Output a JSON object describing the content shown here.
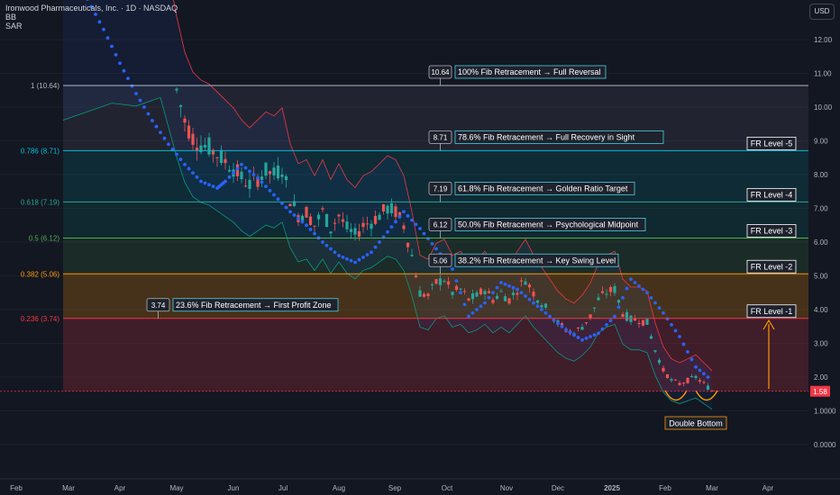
{
  "header": {
    "title": "Ironwood Pharmaceuticals, Inc. · 1D · NASDAQ",
    "indicator_1": "BB",
    "indicator_2": "SAR",
    "currency_button": "USD"
  },
  "colors": {
    "background": "#131722",
    "candle_up": "#26a69a",
    "candle_down": "#ef5350",
    "sar_dots": "#2962ff",
    "bb_band": "#089981",
    "accent_orange": "#ff9800",
    "label_border": "#4dd0e1",
    "price_tag": "#f23645"
  },
  "chart_data": {
    "type": "candlestick",
    "y_axis": {
      "ticks": [
        "12.00",
        "11.00",
        "10.00",
        "9.00",
        "8.00",
        "7.00",
        "6.00",
        "5.00",
        "4.00",
        "3.00",
        "2.00",
        "1.0000",
        "0.0000"
      ],
      "range": [
        -0.3,
        12.5
      ]
    },
    "x_axis": {
      "labels": [
        "Feb",
        "Mar",
        "Apr",
        "May",
        "Jun",
        "Jul",
        "Aug",
        "Sep",
        "Oct",
        "Nov",
        "Dec",
        "2025",
        "Feb",
        "Mar",
        "Apr"
      ]
    },
    "last_price": "1.58",
    "fib_levels": [
      {
        "label": "1 (10.64)",
        "value": 10.64
      },
      {
        "label": "0.786 (8.71)",
        "value": 8.71
      },
      {
        "label": "0.618 (7.19)",
        "value": 7.19
      },
      {
        "label": "0.5 (6.12)",
        "value": 6.12
      },
      {
        "label": "0.382 (5.06)",
        "value": 5.06
      },
      {
        "label": "0.236 (3.74)",
        "value": 3.74
      }
    ],
    "annotations": [
      {
        "value_label": "10.64",
        "text": "100% Fib Retracement → Full Reversal",
        "y": 10.64
      },
      {
        "value_label": "8.71",
        "text": "78.6% Fib Retracement → Full Recovery in Sight",
        "y": 8.71
      },
      {
        "value_label": "7.19",
        "text": "61.8% Fib Retracement → Golden Ratio Target",
        "y": 7.19
      },
      {
        "value_label": "6.12",
        "text": "50.0% Fib Retracement → Psychological Midpoint",
        "y": 6.12
      },
      {
        "value_label": "5.06",
        "text": "38.2% Fib Retracement → Key Swing Level",
        "y": 5.06
      },
      {
        "value_label": "3.74",
        "text": "23.6% Fib Retracement → First Profit Zone",
        "y": 3.74
      }
    ],
    "fr_levels": [
      {
        "label": "FR Level -5",
        "y": 8.71
      },
      {
        "label": "FR Level -4",
        "y": 7.19
      },
      {
        "label": "FR Level -3",
        "y": 6.12
      },
      {
        "label": "FR Level -2",
        "y": 5.06
      },
      {
        "label": "FR Level -1",
        "y": 3.74
      }
    ],
    "pattern_label": "Double Bottom",
    "price_path": [
      [
        0,
        11.8
      ],
      [
        3,
        12.1
      ],
      [
        6,
        12.4
      ],
      [
        9,
        12.3
      ],
      [
        12,
        12.6
      ],
      [
        14,
        10.5
      ],
      [
        15,
        9.6
      ],
      [
        16,
        9.1
      ],
      [
        17,
        8.9
      ],
      [
        18,
        8.8
      ],
      [
        19,
        8.6
      ],
      [
        20,
        8.4
      ],
      [
        21,
        8.2
      ],
      [
        22,
        7.9
      ],
      [
        23,
        7.7
      ],
      [
        24,
        7.9
      ],
      [
        25,
        8.1
      ],
      [
        26,
        8.0
      ],
      [
        27,
        8.2
      ],
      [
        28,
        7.3
      ],
      [
        29,
        6.8
      ],
      [
        30,
        6.9
      ],
      [
        31,
        6.5
      ],
      [
        32,
        6.9
      ],
      [
        33,
        6.4
      ],
      [
        34,
        6.8
      ],
      [
        35,
        6.4
      ],
      [
        36,
        6.2
      ],
      [
        37,
        6.5
      ],
      [
        38,
        6.6
      ],
      [
        39,
        6.8
      ],
      [
        40,
        7.0
      ],
      [
        41,
        6.9
      ],
      [
        42,
        6.5
      ],
      [
        43,
        5.6
      ],
      [
        44,
        4.5
      ],
      [
        45,
        4.4
      ],
      [
        46,
        4.8
      ],
      [
        47,
        4.9
      ],
      [
        48,
        4.5
      ],
      [
        49,
        4.6
      ],
      [
        50,
        4.3
      ],
      [
        51,
        4.4
      ],
      [
        52,
        4.6
      ],
      [
        53,
        4.3
      ],
      [
        54,
        4.5
      ],
      [
        55,
        4.3
      ],
      [
        56,
        4.6
      ],
      [
        57,
        4.9
      ],
      [
        58,
        4.5
      ],
      [
        59,
        4.2
      ],
      [
        60,
        3.9
      ],
      [
        61,
        3.6
      ],
      [
        62,
        3.4
      ],
      [
        63,
        3.3
      ],
      [
        64,
        3.5
      ],
      [
        65,
        3.8
      ],
      [
        66,
        4.3
      ],
      [
        67,
        4.5
      ],
      [
        68,
        4.6
      ],
      [
        69,
        3.9
      ],
      [
        70,
        3.7
      ],
      [
        71,
        3.7
      ],
      [
        72,
        3.6
      ],
      [
        73,
        2.8
      ],
      [
        74,
        2.2
      ],
      [
        75,
        1.9
      ],
      [
        76,
        1.8
      ],
      [
        77,
        1.9
      ],
      [
        78,
        2.0
      ],
      [
        79,
        1.8
      ],
      [
        80,
        1.6
      ]
    ],
    "sar_path": [
      [
        3,
        13.2
      ],
      [
        5,
        12.3
      ],
      [
        7,
        11.3
      ],
      [
        9,
        10.4
      ],
      [
        11,
        9.6
      ],
      [
        13,
        8.9
      ],
      [
        15,
        8.3
      ],
      [
        17,
        7.8
      ],
      [
        19,
        7.6
      ],
      [
        20,
        7.8
      ],
      [
        22,
        8.3
      ],
      [
        24,
        7.9
      ],
      [
        26,
        7.4
      ],
      [
        28,
        6.9
      ],
      [
        30,
        6.5
      ],
      [
        32,
        6.0
      ],
      [
        34,
        5.6
      ],
      [
        36,
        5.4
      ],
      [
        38,
        5.7
      ],
      [
        40,
        6.3
      ],
      [
        42,
        6.9
      ],
      [
        44,
        6.4
      ],
      [
        46,
        5.8
      ],
      [
        48,
        5.2
      ],
      [
        50,
        3.8
      ],
      [
        52,
        4.2
      ],
      [
        54,
        4.8
      ],
      [
        56,
        4.6
      ],
      [
        58,
        4.2
      ],
      [
        60,
        3.8
      ],
      [
        62,
        3.4
      ],
      [
        64,
        3.1
      ],
      [
        66,
        3.3
      ],
      [
        68,
        3.8
      ],
      [
        70,
        4.9
      ],
      [
        72,
        4.5
      ],
      [
        74,
        3.9
      ],
      [
        76,
        3.2
      ],
      [
        78,
        2.3
      ],
      [
        80,
        1.9
      ]
    ]
  }
}
